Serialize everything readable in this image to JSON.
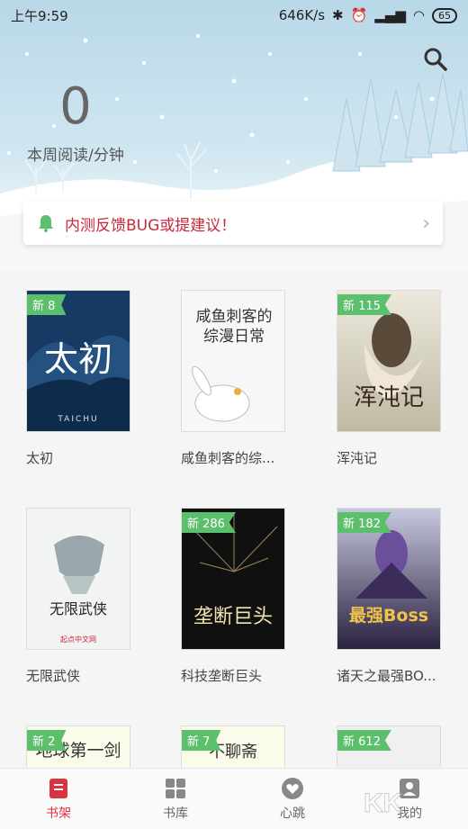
{
  "status_bar": {
    "time": "上午9:59",
    "net_speed": "646K/s",
    "battery": "65"
  },
  "stats": {
    "value": "0",
    "label": "本周阅读/分钟"
  },
  "notice": {
    "text": "内测反馈BUG或提建议！"
  },
  "books": [
    {
      "title": "太初",
      "badge": "新 8",
      "cover_text": "太初",
      "cover_sub": "TAICHU",
      "cover_color": "#163a63"
    },
    {
      "title": "咸鱼刺客的综...",
      "badge": "",
      "cover_text": "咸鱼刺客的综漫日常",
      "cover_color": "#f7f7f7"
    },
    {
      "title": "浑沌记",
      "badge": "新 115",
      "cover_text": "浑沌记",
      "cover_color": "#d9d6c9"
    },
    {
      "title": "无限武侠",
      "badge": "",
      "cover_text": "无限武侠",
      "cover_sub": "起点中文网",
      "cover_color": "#f2f4f4"
    },
    {
      "title": "科技垄断巨头",
      "badge": "新 286",
      "cover_text": "垄断巨头",
      "cover_color": "#101010"
    },
    {
      "title": "诸天之最强BO...",
      "badge": "新 182",
      "cover_text": "最强Boss",
      "cover_color": "#2a2140"
    },
    {
      "title": "",
      "badge": "新 2",
      "cover_text": "地球第一剑",
      "cover_color": "#fbfbe9"
    },
    {
      "title": "",
      "badge": "新 7",
      "cover_text": "不聊斋",
      "cover_color": "#fbfbe9"
    },
    {
      "title": "",
      "badge": "新 612",
      "cover_text": "",
      "cover_color": "#f0f0f0"
    }
  ],
  "nav": [
    {
      "label": "书架",
      "icon": "bookshelf-icon",
      "active": true
    },
    {
      "label": "书库",
      "icon": "library-grid-icon",
      "active": false
    },
    {
      "label": "心跳",
      "icon": "heart-icon",
      "active": false
    },
    {
      "label": "我的",
      "icon": "profile-icon",
      "active": false
    }
  ],
  "colors": {
    "accent": "#d9333f",
    "badge": "#5bbf6b",
    "notice_text": "#c8283a"
  }
}
